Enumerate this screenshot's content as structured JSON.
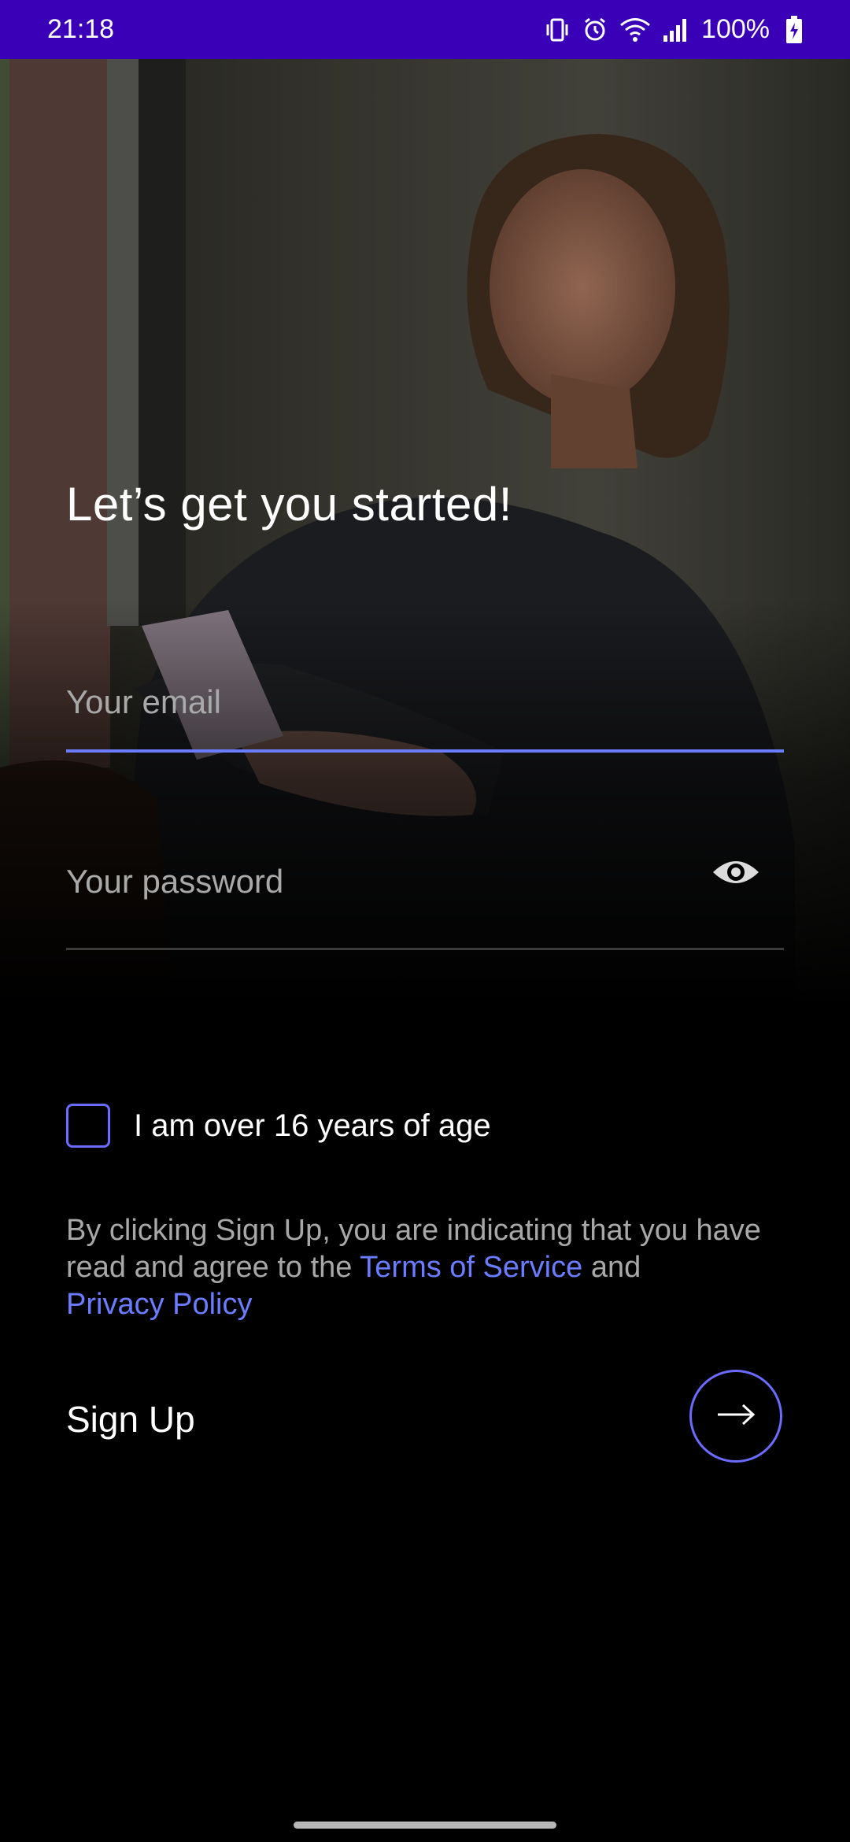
{
  "status_bar": {
    "time": "21:18",
    "battery_percent": "100%",
    "icons": [
      "vibrate-icon",
      "alarm-icon",
      "wifi-icon",
      "signal-icon",
      "battery-charging-icon"
    ]
  },
  "hero": {
    "image": "photo-woman-with-phone"
  },
  "signup": {
    "title": "Let’s get you started!",
    "email_placeholder": "Your email",
    "email_value": "",
    "password_placeholder": "Your password",
    "password_value": "",
    "age_checkbox_label": "I am over 16 years of age",
    "age_checked": false,
    "terms_prefix": "By clicking Sign Up, you are indicating that you have read and agree to the",
    "terms_link": "Terms of Service",
    "terms_and": "and",
    "privacy_link": "Privacy Policy",
    "signup_label": "Sign Up"
  },
  "colors": {
    "status_bar": "#3a00b8",
    "accent": "#6b7cff",
    "checkbox_border": "#6b6bff",
    "background": "#000000",
    "muted_text": "#a8a8a8"
  }
}
